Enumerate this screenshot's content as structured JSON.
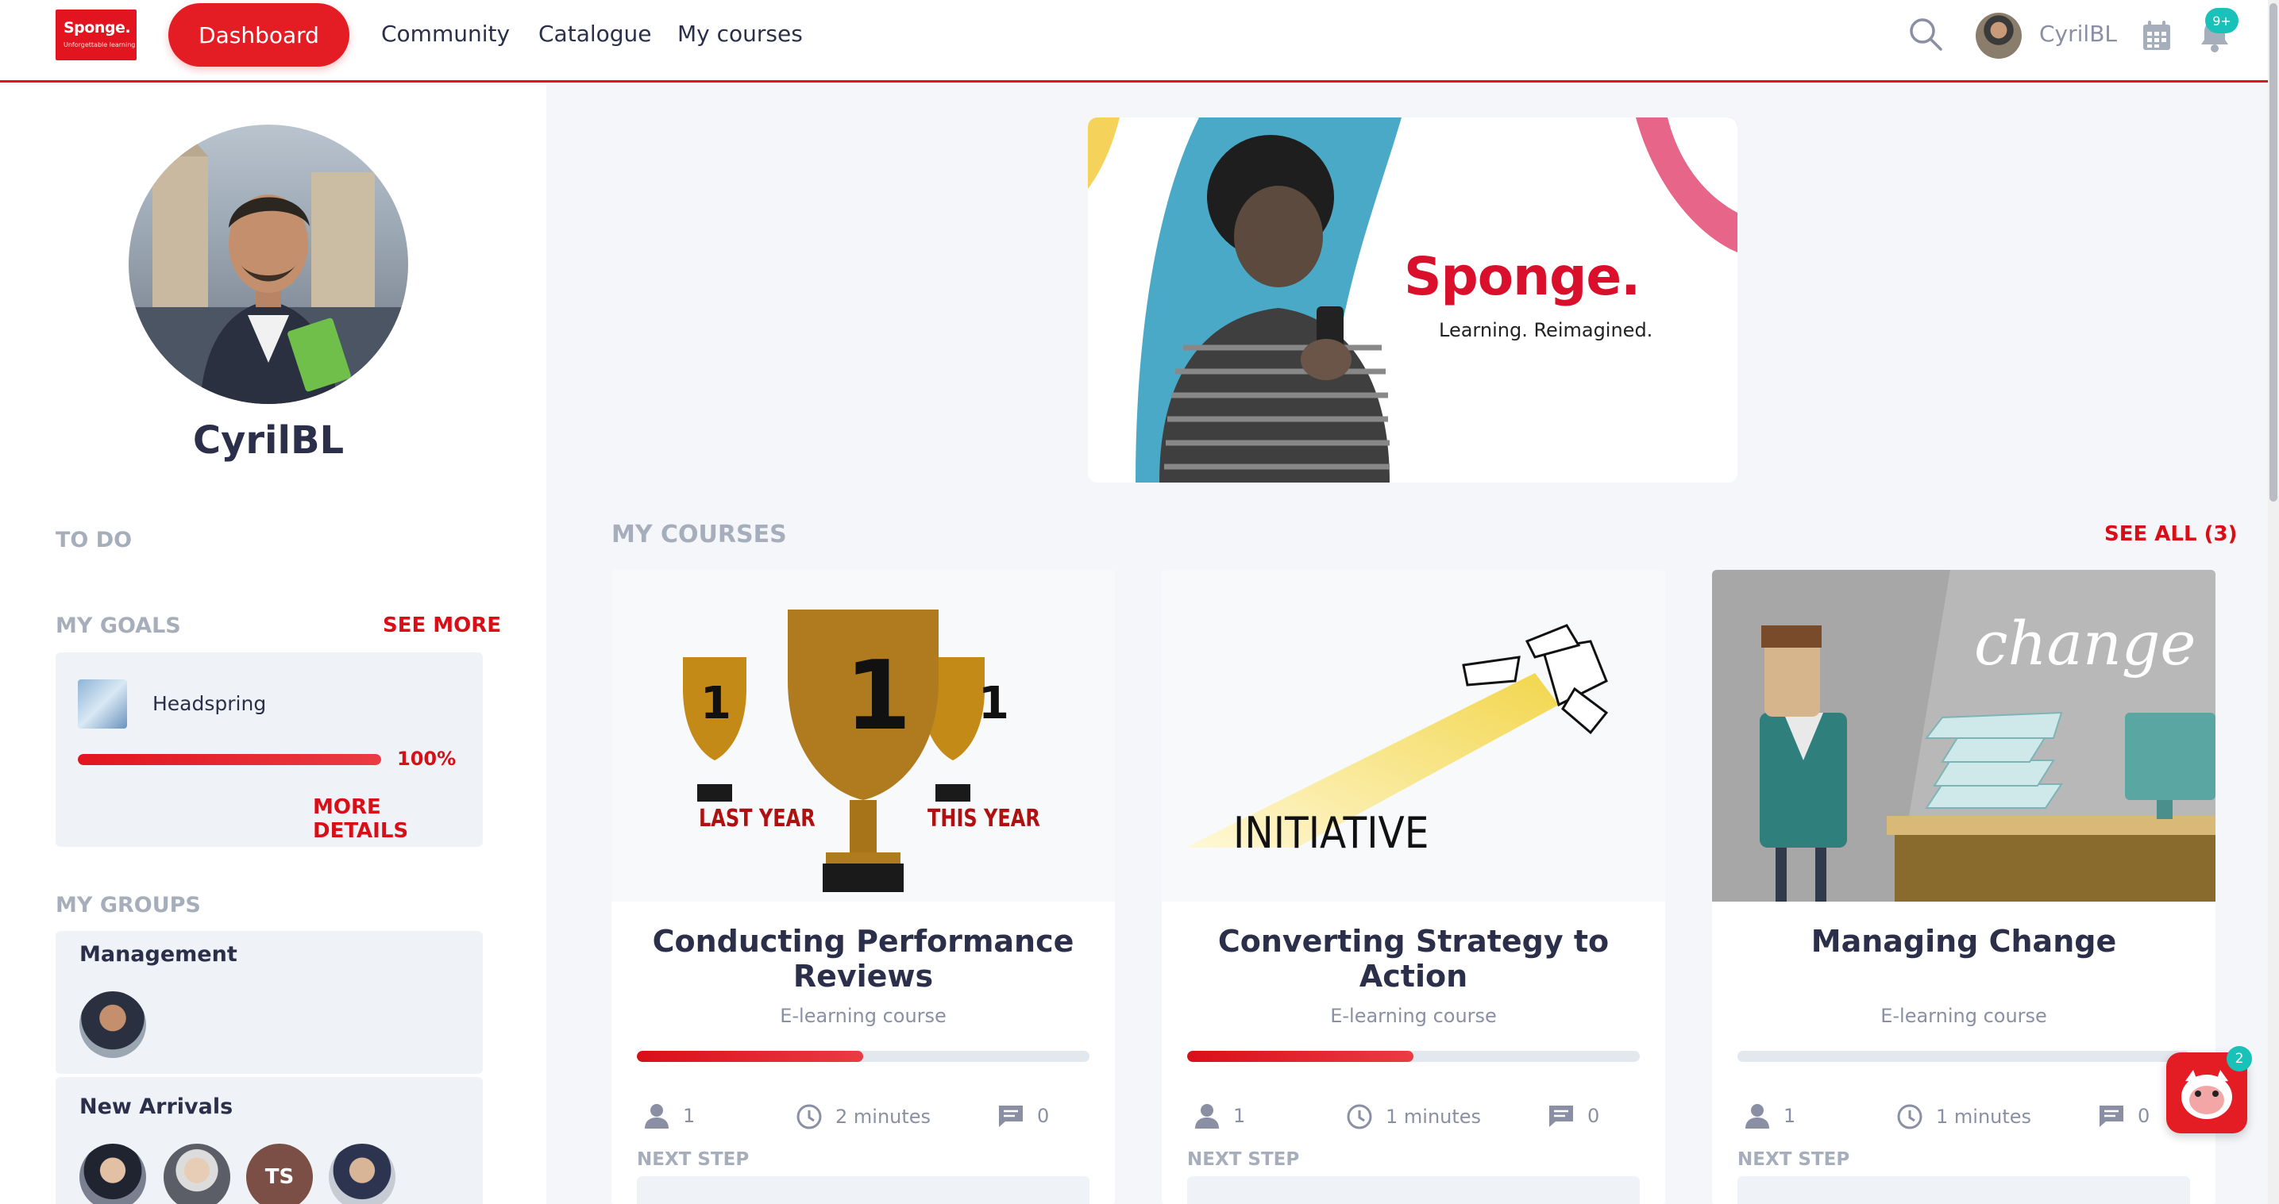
{
  "brand": {
    "logo_text": "Sponge.",
    "logo_tagline": "Unforgettable learning",
    "accent": "#e2141f"
  },
  "nav": {
    "dashboard": "Dashboard",
    "links": [
      "Community",
      "Catalogue",
      "My courses"
    ],
    "user_name": "CyrilBL",
    "notification_count": "9+",
    "icons": [
      "search-icon",
      "calendar-icon",
      "bell-icon"
    ]
  },
  "profile": {
    "name": "CyrilBL"
  },
  "sidebar": {
    "todo_title": "TO DO",
    "goals_title": "MY GOALS",
    "goals_see_more": "SEE MORE",
    "goal": {
      "name": "Headspring",
      "progress": 1.0,
      "progress_label": "100%",
      "more_details": "MORE DETAILS"
    },
    "groups_title": "MY GROUPS",
    "groups": [
      {
        "name": "Management"
      },
      {
        "name": "New Arrivals",
        "initials": "TS"
      }
    ]
  },
  "banner": {
    "brand": "Sponge.",
    "tagline": "Learning. Reimagined."
  },
  "courses_section": {
    "title": "MY COURSES",
    "see_all": "SEE ALL (3)"
  },
  "courses": [
    {
      "title": "Conducting Performance Reviews",
      "type": "E-learning course",
      "progress": 0.5,
      "learners": "1",
      "duration": "2 minutes",
      "comments": "0",
      "next_step": "NEXT STEP",
      "image_labels": {
        "rank": "1",
        "left": "LAST YEAR",
        "right": "THIS YEAR"
      }
    },
    {
      "title": "Converting Strategy to Action",
      "type": "E-learning course",
      "progress": 0.5,
      "learners": "1",
      "duration": "1 minutes",
      "comments": "0",
      "next_step": "NEXT STEP",
      "image_labels": {
        "word": "INITIATIVE"
      }
    },
    {
      "title": "Managing Change",
      "type": "E-learning course",
      "progress": 0.0,
      "learners": "1",
      "duration": "1 minutes",
      "comments": "0",
      "next_step": "NEXT STEP",
      "image_labels": {
        "word": "change"
      }
    }
  ],
  "chat": {
    "unread": "2"
  }
}
